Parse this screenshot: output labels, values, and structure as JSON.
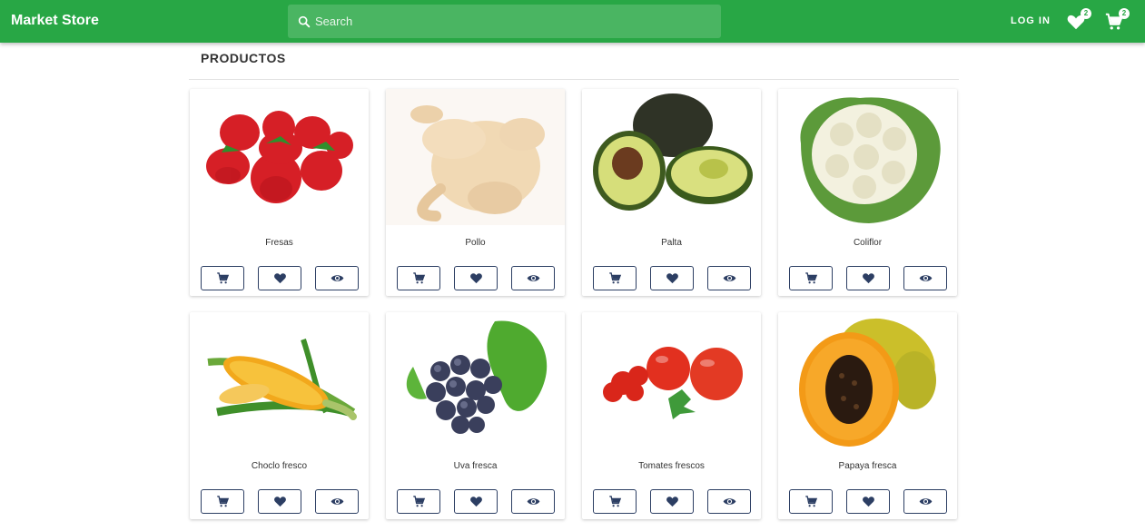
{
  "header": {
    "brand": "Market Store",
    "search_placeholder": "Search",
    "login_label": "LOG IN",
    "favorites_count": "2",
    "cart_count": "2"
  },
  "section": {
    "title": "PRODUCTOS"
  },
  "products": [
    {
      "name": "Fresas",
      "image": "strawberries"
    },
    {
      "name": "Pollo",
      "image": "raw-chicken"
    },
    {
      "name": "Palta",
      "image": "avocado"
    },
    {
      "name": "Coliflor",
      "image": "cauliflower"
    },
    {
      "name": "Choclo fresco",
      "image": "corn"
    },
    {
      "name": "Uva fresca",
      "image": "grapes"
    },
    {
      "name": "Tomates frescos",
      "image": "tomatoes"
    },
    {
      "name": "Papaya fresca",
      "image": "papaya"
    }
  ],
  "colors": {
    "appbar": "#28a745",
    "button_border": "#2c3e63"
  }
}
